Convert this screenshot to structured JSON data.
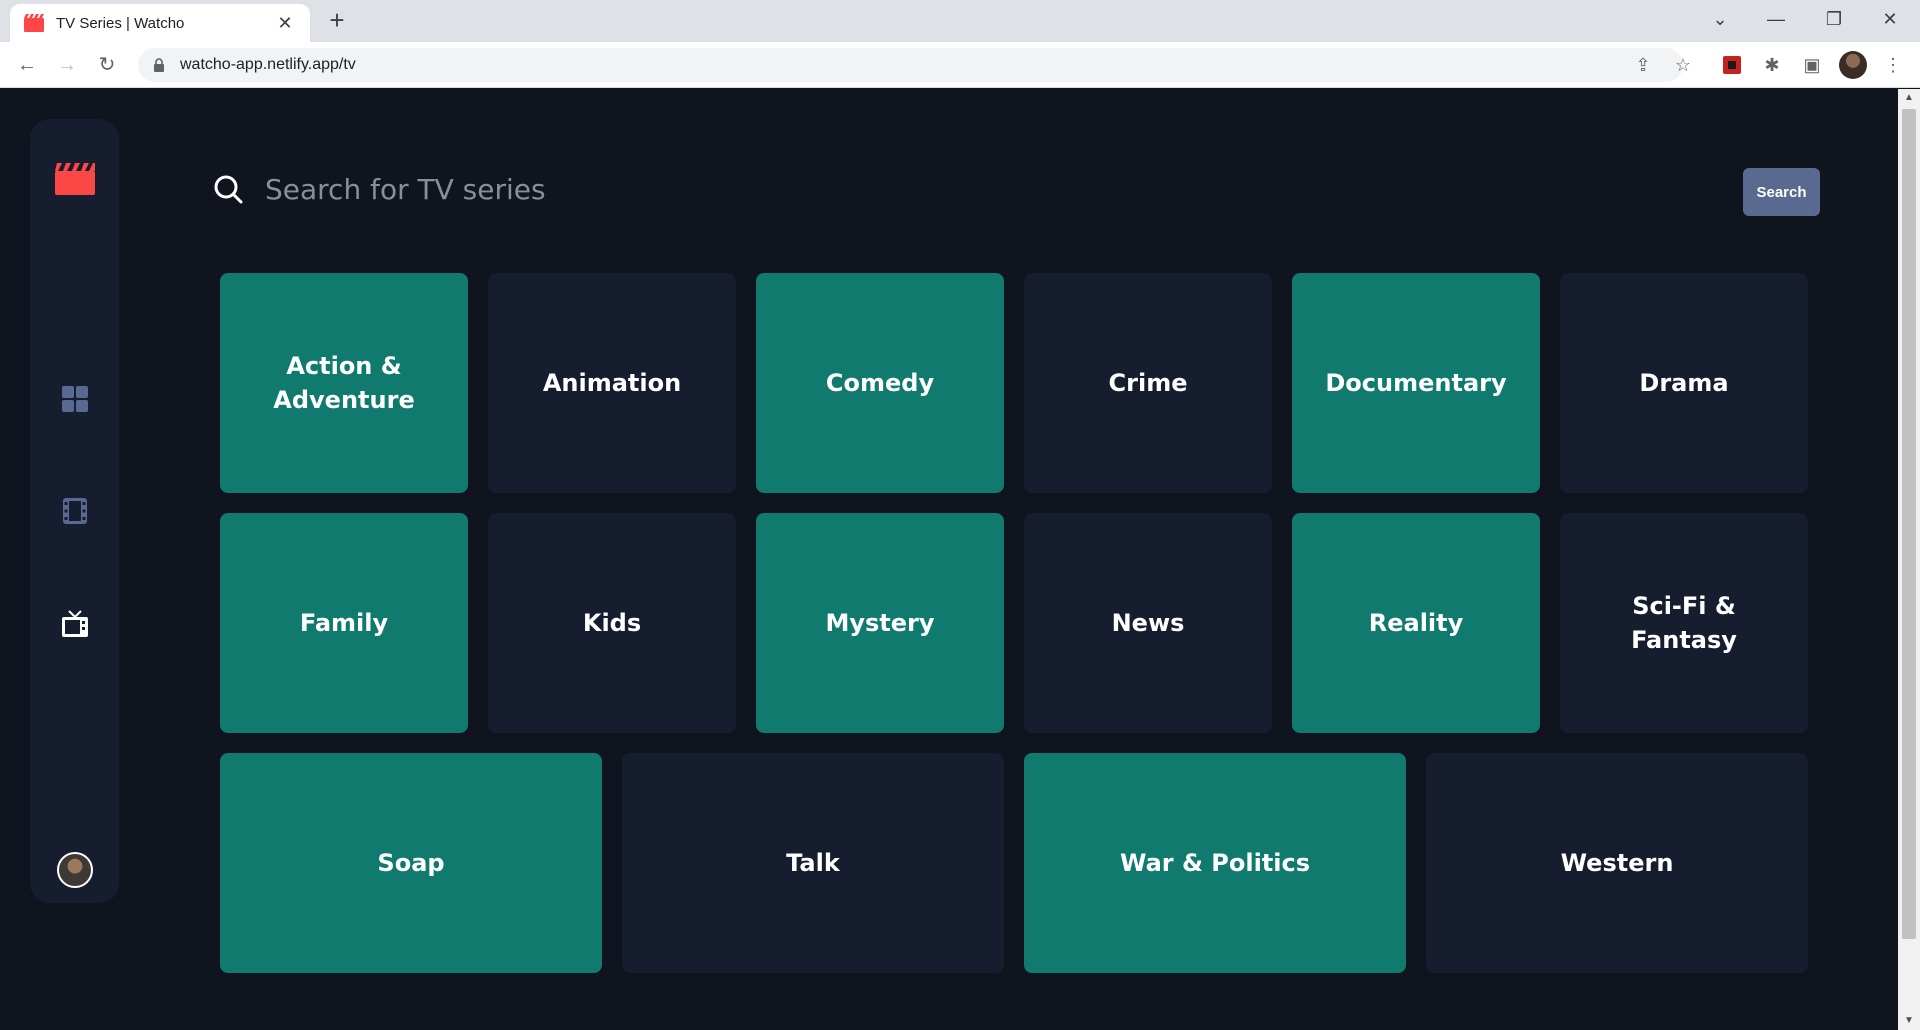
{
  "browser": {
    "tab_title": "TV Series | Watcho",
    "url": "watcho-app.netlify.app/tv",
    "tab_close": "✕",
    "new_tab": "+"
  },
  "colors": {
    "accent_teal": "#107a6f",
    "tile_navy": "#161d2f",
    "background": "#10141e",
    "logo_red": "#fc4747",
    "button": "#5a698f"
  },
  "sidebar": {
    "logo_icon": "clapperboard-icon",
    "items": [
      {
        "name": "home",
        "icon": "grid-icon"
      },
      {
        "name": "movies",
        "icon": "film-strip-icon"
      },
      {
        "name": "tv-series",
        "icon": "tv-icon",
        "active": true
      }
    ],
    "avatar": "user-avatar"
  },
  "search": {
    "placeholder": "Search for TV series",
    "value": "",
    "button_label": "Search"
  },
  "genres": [
    [
      {
        "label": "Action & Adventure",
        "style": "teal"
      },
      {
        "label": "Animation",
        "style": "navy"
      },
      {
        "label": "Comedy",
        "style": "teal"
      },
      {
        "label": "Crime",
        "style": "navy"
      },
      {
        "label": "Documentary",
        "style": "teal"
      },
      {
        "label": "Drama",
        "style": "navy"
      }
    ],
    [
      {
        "label": "Family",
        "style": "teal"
      },
      {
        "label": "Kids",
        "style": "navy"
      },
      {
        "label": "Mystery",
        "style": "teal"
      },
      {
        "label": "News",
        "style": "navy"
      },
      {
        "label": "Reality",
        "style": "teal"
      },
      {
        "label": "Sci-Fi & Fantasy",
        "style": "navy"
      }
    ],
    [
      {
        "label": "Soap",
        "style": "teal"
      },
      {
        "label": "Talk",
        "style": "navy"
      },
      {
        "label": "War & Politics",
        "style": "teal"
      },
      {
        "label": "Western",
        "style": "navy"
      }
    ]
  ]
}
